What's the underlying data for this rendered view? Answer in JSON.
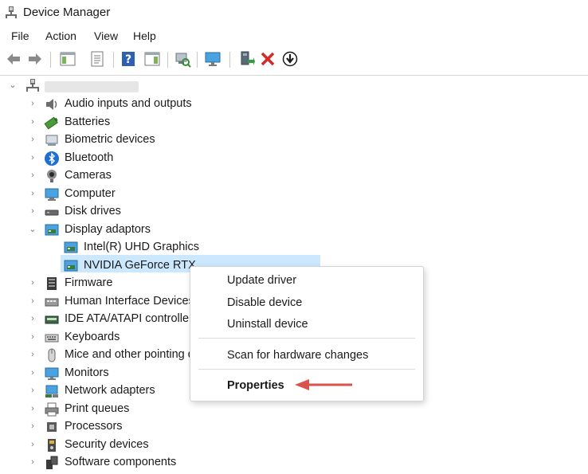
{
  "window": {
    "title": "Device Manager"
  },
  "menubar": {
    "items": [
      "File",
      "Action",
      "View",
      "Help"
    ]
  },
  "toolbar": {
    "buttons": [
      "back-arrow-icon",
      "forward-arrow-icon",
      "show-hide-console-tree-icon",
      "properties-sheet-icon",
      "help-icon",
      "action-pane-icon",
      "scan-hardware-icon",
      "monitor-icon",
      "update-driver-icon",
      "uninstall-device-icon",
      "disable-device-icon"
    ]
  },
  "tree": {
    "root_label": "",
    "categories": [
      {
        "label": "Audio inputs and outputs",
        "icon": "speaker-icon",
        "expanded": false
      },
      {
        "label": "Batteries",
        "icon": "battery-icon",
        "expanded": false
      },
      {
        "label": "Biometric devices",
        "icon": "biometric-icon",
        "expanded": false
      },
      {
        "label": "Bluetooth",
        "icon": "bluetooth-icon",
        "expanded": false
      },
      {
        "label": "Cameras",
        "icon": "camera-icon",
        "expanded": false
      },
      {
        "label": "Computer",
        "icon": "computer-icon",
        "expanded": false
      },
      {
        "label": "Disk drives",
        "icon": "disk-drive-icon",
        "expanded": false
      },
      {
        "label": "Display adaptors",
        "icon": "display-adapter-icon",
        "expanded": true
      },
      {
        "label": "Firmware",
        "icon": "firmware-icon",
        "expanded": false
      },
      {
        "label": "Human Interface Devices",
        "icon": "hid-icon",
        "expanded": false
      },
      {
        "label": "IDE ATA/ATAPI controllers",
        "icon": "ide-controller-icon",
        "expanded": false
      },
      {
        "label": "Keyboards",
        "icon": "keyboard-icon",
        "expanded": false
      },
      {
        "label": "Mice and other pointing devices",
        "icon": "mouse-icon",
        "expanded": false
      },
      {
        "label": "Monitors",
        "icon": "monitor-icon",
        "expanded": false
      },
      {
        "label": "Network adapters",
        "icon": "network-adapter-icon",
        "expanded": false
      },
      {
        "label": "Print queues",
        "icon": "printer-icon",
        "expanded": false
      },
      {
        "label": "Processors",
        "icon": "processor-icon",
        "expanded": false
      },
      {
        "label": "Security devices",
        "icon": "security-device-icon",
        "expanded": false
      },
      {
        "label": "Software components",
        "icon": "software-component-icon",
        "expanded": false
      }
    ],
    "display_children": [
      {
        "label": "Intel(R) UHD Graphics",
        "icon": "display-adapter-icon",
        "selected": false
      },
      {
        "label": "NVIDIA GeForce RTX",
        "icon": "display-adapter-icon",
        "selected": true
      }
    ]
  },
  "context_menu": {
    "items": [
      {
        "label": "Update driver"
      },
      {
        "label": "Disable device"
      },
      {
        "label": "Uninstall device"
      },
      {
        "label": "Scan for hardware changes"
      },
      {
        "label": "Properties",
        "bold": true
      }
    ]
  },
  "colors": {
    "selection": "#cce8ff",
    "annotation_arrow": "#d9534a"
  }
}
